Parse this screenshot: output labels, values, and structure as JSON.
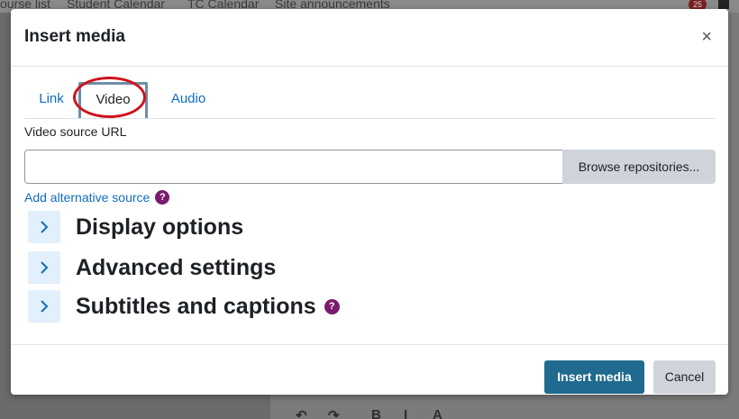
{
  "background": {
    "nav_items": [
      "ourse list",
      "Student Calendar",
      "TC Calendar",
      "Site announcements"
    ],
    "notification_count": "25",
    "toolbar_glyphs": [
      "↶",
      "↷",
      "B",
      "I",
      "A"
    ]
  },
  "modal": {
    "title": "Insert media",
    "close_label": "×",
    "tabs": [
      {
        "label": "Link"
      },
      {
        "label": "Video"
      },
      {
        "label": "Audio"
      }
    ],
    "video": {
      "source_label": "Video source URL",
      "source_value": "",
      "browse_label": "Browse repositories...",
      "alt_source_label": "Add alternative source",
      "help_glyph": "?"
    },
    "sections": [
      {
        "label": "Display options"
      },
      {
        "label": "Advanced settings"
      },
      {
        "label": "Subtitles and captions"
      }
    ],
    "footer": {
      "primary_label": "Insert media",
      "cancel_label": "Cancel"
    }
  },
  "colors": {
    "link_blue": "#0f6cbf",
    "primary_button": "#1f6a8e",
    "help_purple": "#7a1b6c",
    "highlight_red": "#d0121b"
  }
}
